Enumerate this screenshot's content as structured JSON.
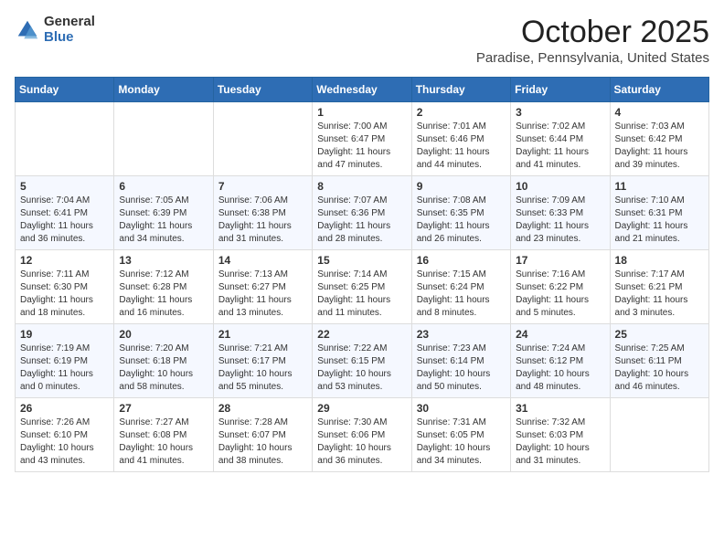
{
  "logo": {
    "general": "General",
    "blue": "Blue"
  },
  "title": "October 2025",
  "location": "Paradise, Pennsylvania, United States",
  "days_of_week": [
    "Sunday",
    "Monday",
    "Tuesday",
    "Wednesday",
    "Thursday",
    "Friday",
    "Saturday"
  ],
  "weeks": [
    [
      {
        "day": "",
        "info": ""
      },
      {
        "day": "",
        "info": ""
      },
      {
        "day": "",
        "info": ""
      },
      {
        "day": "1",
        "info": "Sunrise: 7:00 AM\nSunset: 6:47 PM\nDaylight: 11 hours and 47 minutes."
      },
      {
        "day": "2",
        "info": "Sunrise: 7:01 AM\nSunset: 6:46 PM\nDaylight: 11 hours and 44 minutes."
      },
      {
        "day": "3",
        "info": "Sunrise: 7:02 AM\nSunset: 6:44 PM\nDaylight: 11 hours and 41 minutes."
      },
      {
        "day": "4",
        "info": "Sunrise: 7:03 AM\nSunset: 6:42 PM\nDaylight: 11 hours and 39 minutes."
      }
    ],
    [
      {
        "day": "5",
        "info": "Sunrise: 7:04 AM\nSunset: 6:41 PM\nDaylight: 11 hours and 36 minutes."
      },
      {
        "day": "6",
        "info": "Sunrise: 7:05 AM\nSunset: 6:39 PM\nDaylight: 11 hours and 34 minutes."
      },
      {
        "day": "7",
        "info": "Sunrise: 7:06 AM\nSunset: 6:38 PM\nDaylight: 11 hours and 31 minutes."
      },
      {
        "day": "8",
        "info": "Sunrise: 7:07 AM\nSunset: 6:36 PM\nDaylight: 11 hours and 28 minutes."
      },
      {
        "day": "9",
        "info": "Sunrise: 7:08 AM\nSunset: 6:35 PM\nDaylight: 11 hours and 26 minutes."
      },
      {
        "day": "10",
        "info": "Sunrise: 7:09 AM\nSunset: 6:33 PM\nDaylight: 11 hours and 23 minutes."
      },
      {
        "day": "11",
        "info": "Sunrise: 7:10 AM\nSunset: 6:31 PM\nDaylight: 11 hours and 21 minutes."
      }
    ],
    [
      {
        "day": "12",
        "info": "Sunrise: 7:11 AM\nSunset: 6:30 PM\nDaylight: 11 hours and 18 minutes."
      },
      {
        "day": "13",
        "info": "Sunrise: 7:12 AM\nSunset: 6:28 PM\nDaylight: 11 hours and 16 minutes."
      },
      {
        "day": "14",
        "info": "Sunrise: 7:13 AM\nSunset: 6:27 PM\nDaylight: 11 hours and 13 minutes."
      },
      {
        "day": "15",
        "info": "Sunrise: 7:14 AM\nSunset: 6:25 PM\nDaylight: 11 hours and 11 minutes."
      },
      {
        "day": "16",
        "info": "Sunrise: 7:15 AM\nSunset: 6:24 PM\nDaylight: 11 hours and 8 minutes."
      },
      {
        "day": "17",
        "info": "Sunrise: 7:16 AM\nSunset: 6:22 PM\nDaylight: 11 hours and 5 minutes."
      },
      {
        "day": "18",
        "info": "Sunrise: 7:17 AM\nSunset: 6:21 PM\nDaylight: 11 hours and 3 minutes."
      }
    ],
    [
      {
        "day": "19",
        "info": "Sunrise: 7:19 AM\nSunset: 6:19 PM\nDaylight: 11 hours and 0 minutes."
      },
      {
        "day": "20",
        "info": "Sunrise: 7:20 AM\nSunset: 6:18 PM\nDaylight: 10 hours and 58 minutes."
      },
      {
        "day": "21",
        "info": "Sunrise: 7:21 AM\nSunset: 6:17 PM\nDaylight: 10 hours and 55 minutes."
      },
      {
        "day": "22",
        "info": "Sunrise: 7:22 AM\nSunset: 6:15 PM\nDaylight: 10 hours and 53 minutes."
      },
      {
        "day": "23",
        "info": "Sunrise: 7:23 AM\nSunset: 6:14 PM\nDaylight: 10 hours and 50 minutes."
      },
      {
        "day": "24",
        "info": "Sunrise: 7:24 AM\nSunset: 6:12 PM\nDaylight: 10 hours and 48 minutes."
      },
      {
        "day": "25",
        "info": "Sunrise: 7:25 AM\nSunset: 6:11 PM\nDaylight: 10 hours and 46 minutes."
      }
    ],
    [
      {
        "day": "26",
        "info": "Sunrise: 7:26 AM\nSunset: 6:10 PM\nDaylight: 10 hours and 43 minutes."
      },
      {
        "day": "27",
        "info": "Sunrise: 7:27 AM\nSunset: 6:08 PM\nDaylight: 10 hours and 41 minutes."
      },
      {
        "day": "28",
        "info": "Sunrise: 7:28 AM\nSunset: 6:07 PM\nDaylight: 10 hours and 38 minutes."
      },
      {
        "day": "29",
        "info": "Sunrise: 7:30 AM\nSunset: 6:06 PM\nDaylight: 10 hours and 36 minutes."
      },
      {
        "day": "30",
        "info": "Sunrise: 7:31 AM\nSunset: 6:05 PM\nDaylight: 10 hours and 34 minutes."
      },
      {
        "day": "31",
        "info": "Sunrise: 7:32 AM\nSunset: 6:03 PM\nDaylight: 10 hours and 31 minutes."
      },
      {
        "day": "",
        "info": ""
      }
    ]
  ]
}
